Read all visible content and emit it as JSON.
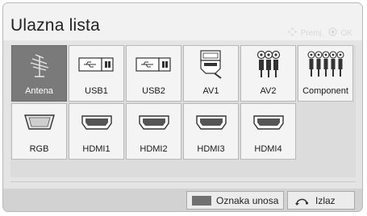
{
  "title": "Ulazna lista",
  "hint": {
    "move_label": "Premj.",
    "ok_label": "OK",
    "move_icon": "arrows-icon",
    "ok_icon": "ok-circle-icon"
  },
  "inputs": [
    {
      "label": "Antena",
      "icon": "antenna-icon",
      "selected": true
    },
    {
      "label": "USB1",
      "icon": "usb-icon",
      "selected": false
    },
    {
      "label": "USB2",
      "icon": "usb-icon",
      "selected": false
    },
    {
      "label": "AV1",
      "icon": "scart-icon",
      "selected": false
    },
    {
      "label": "AV2",
      "icon": "rca-icon",
      "selected": false
    },
    {
      "label": "Component",
      "icon": "component-icon",
      "selected": false
    },
    {
      "label": "RGB",
      "icon": "vga-icon",
      "selected": false
    },
    {
      "label": "HDMI1",
      "icon": "hdmi-icon",
      "selected": false
    },
    {
      "label": "HDMI2",
      "icon": "hdmi-icon",
      "selected": false
    },
    {
      "label": "HDMI3",
      "icon": "hdmi-icon",
      "selected": false
    },
    {
      "label": "HDMI4",
      "icon": "hdmi-icon",
      "selected": false
    }
  ],
  "footer": {
    "label_input": "Oznaka unosa",
    "exit": "Izlaz",
    "label_input_icon": "gray-button-icon",
    "exit_icon": "return-icon"
  },
  "colors": {
    "selected": "#7a7a7a",
    "tile": "#f4f4f4",
    "panel": "#e4e4e4"
  }
}
